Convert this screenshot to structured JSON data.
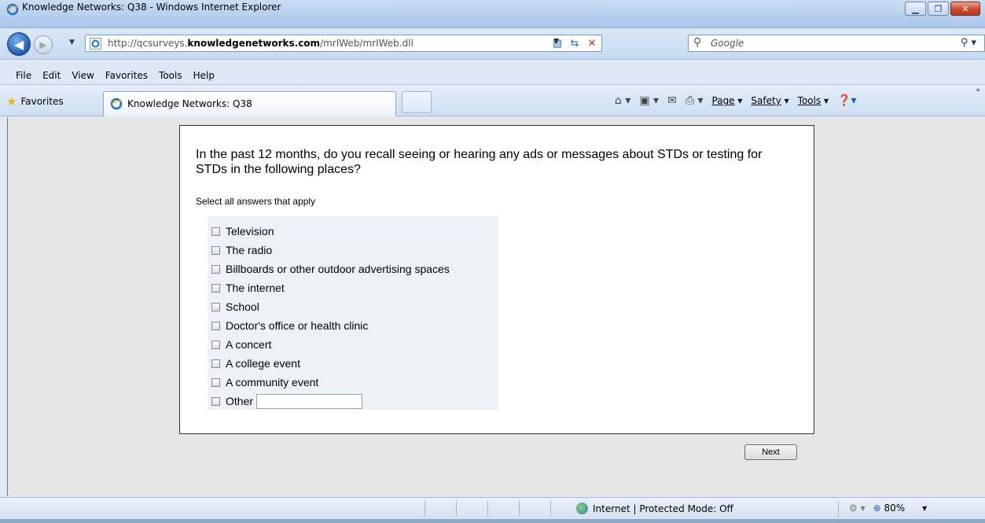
{
  "window": {
    "title": "Knowledge Networks: Q38 - Windows Internet Explorer",
    "controls": [
      "minimize",
      "maximize",
      "close"
    ]
  },
  "address_bar": {
    "url_prefix": "http://qcsurveys.",
    "url_domain": "knowledgenetworks.com",
    "url_path": "/mrIWeb/mrIWeb.dll"
  },
  "search": {
    "placeholder": "Google"
  },
  "menu": {
    "items": [
      "File",
      "Edit",
      "View",
      "Favorites",
      "Tools",
      "Help"
    ]
  },
  "favorites_bar": {
    "favorites_label": "Favorites",
    "tab_label": "Knowledge Networks: Q38"
  },
  "command_bar": {
    "page": "Page",
    "safety": "Safety",
    "tools": "Tools"
  },
  "survey": {
    "question": "In the past 12 months, do you recall seeing or hearing any ads or messages about STDs or testing for STDs in the following places?",
    "instruction": "Select all answers that apply",
    "options": [
      "Television",
      "The radio",
      "Billboards or other outdoor advertising spaces",
      "The internet",
      "School",
      "Doctor's office or health clinic",
      "A concert",
      "A college event",
      "A community event",
      "Other"
    ],
    "next_label": "Next"
  },
  "status_bar": {
    "zone": "Internet | Protected Mode: Off",
    "zoom": "80%"
  }
}
